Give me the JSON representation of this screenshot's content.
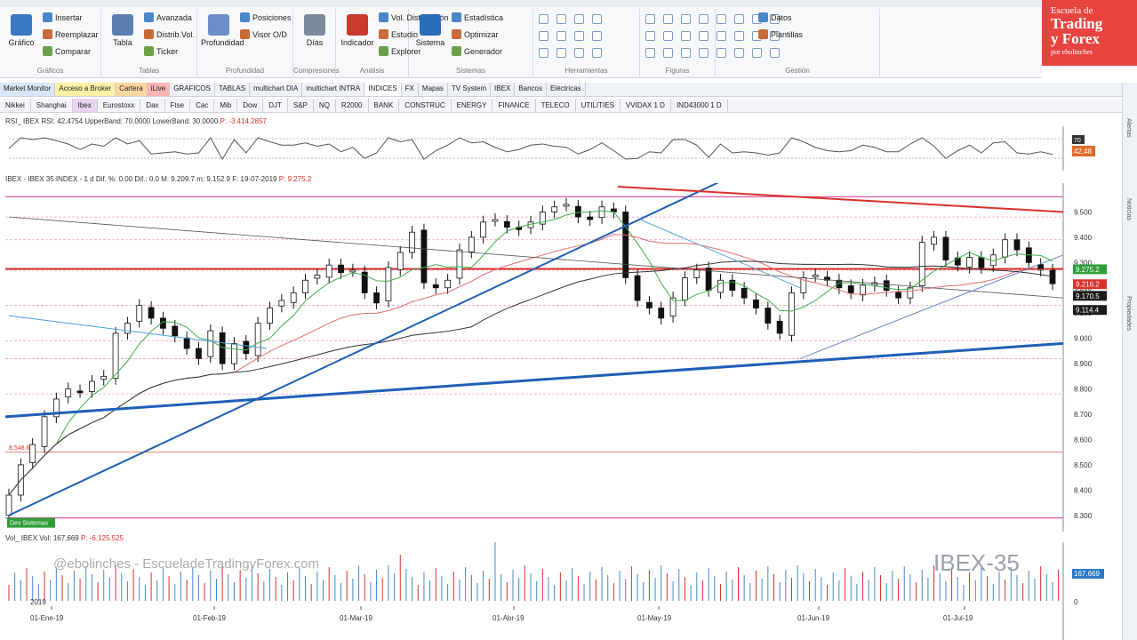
{
  "ribbon": {
    "groups": [
      {
        "label": "Gráficos",
        "big": "Gráfico",
        "items": [
          "Insertar",
          "Reemplazar",
          "Comparar"
        ]
      },
      {
        "label": "Tablas",
        "big": "Tabla",
        "items": [
          "Avanzada",
          "Distrib.Vol.",
          "Ticker"
        ]
      },
      {
        "label": "Profundidad",
        "big": "Profundidad",
        "items": [
          "Posiciones",
          "Visor O/D"
        ]
      },
      {
        "label": "Compresiones",
        "big": "Días",
        "items": []
      },
      {
        "label": "Análisis",
        "big": "Indicador",
        "items": [
          "Vol. Distribución",
          "Estudio",
          "Explorer"
        ]
      },
      {
        "label": "Sistemas",
        "big": "Sistema",
        "items": [
          "Estadística",
          "Optimizar",
          "Generador"
        ]
      },
      {
        "label": "Herramientas",
        "big": "",
        "items": []
      },
      {
        "label": "Figuras",
        "big": "",
        "items": []
      },
      {
        "label": "Gestión",
        "big": "",
        "items": [
          "Datos",
          "Plantillas"
        ]
      }
    ]
  },
  "logo": {
    "line1": "Escuela de",
    "line2": "Trading",
    "line3": "y Forex",
    "line4": "por ebolinches"
  },
  "tabs": [
    "Market Monitor",
    "Acceso a Broker",
    "Cartera",
    "iLive",
    "GRAFICOS",
    "TABLAS",
    "multichart DIA",
    "multichart INTRA",
    "INDICES",
    "FX",
    "Mapas",
    "TV System",
    "IBEX",
    "Bancos",
    "Eléctricas"
  ],
  "subtabs": [
    "Nikkei",
    "Shanghai",
    "Ibex",
    "Eurostoxx",
    "Dax",
    "Ftse",
    "Cac",
    "Mib",
    "Dow",
    "DJT",
    "S&P",
    "NQ",
    "R2000",
    "BANK",
    "CONSTRUC",
    "ENERGY",
    "FINANCE",
    "TELECO",
    "UTILITIES",
    "VVIDAX 1 D",
    "IND43000 1 D"
  ],
  "rsi": {
    "title": "RSI_ IBEX RSI: 42.4754 UpperBand: 70.0000 LowerBand: 30.0000",
    "p_label": "P: -3.414.2857",
    "badge_upper": "70",
    "badge_value": "42.48"
  },
  "price_panel": {
    "title": "IBEX - IBEX 35 INDEX - 1 d Dif. %: 0.00 Dif.: 0.0 M: 9.209.7 m: 9.152.9 F: 19-07-2019",
    "p_label": "P: 9.275.2",
    "left_label_1": "8.548.6",
    "left_label_2": "Dev Sistemas"
  },
  "y_axis": [
    "9.500",
    "9.400",
    "9.300",
    "9.200",
    "9.100",
    "9.000",
    "8.900",
    "8.800",
    "8.700",
    "8.600",
    "8.500",
    "8.400",
    "8.300"
  ],
  "price_badges": [
    {
      "text": "9.275.2",
      "color": "#2e9e3a"
    },
    {
      "text": "9.216.2",
      "color": "#d9302c"
    },
    {
      "text": "9.170.5",
      "color": "#1a1a1a"
    },
    {
      "text": "9.114.4",
      "color": "#1a1a1a"
    }
  ],
  "volume": {
    "title": "Vol_ IBEX Vol: 167.669",
    "p_label": "P: -6.125.525",
    "badge": "167.669",
    "zero": "0"
  },
  "x_axis": [
    "01-Ene-19",
    "01-Feb-19",
    "01-Mar-19",
    "01-Abr-19",
    "01-May-19",
    "01-Jun-19",
    "01-Jul-19"
  ],
  "year_label": "2019",
  "watermark": "@ebolinches - EscueladeTradingyForex.com",
  "symbol_watermark": "IBEX-35",
  "sidebar": [
    "Alertas",
    "Noticias",
    "Propiedades"
  ],
  "colors": {
    "up": "#ffffff",
    "down": "#111111",
    "trend_blue": "#1f5fb8",
    "resist_red": "#d9302c",
    "pink_level": "#e05aa0"
  },
  "chart_data": {
    "type": "candlestick",
    "title": "IBEX - IBEX 35 INDEX - 1 d",
    "ylim": [
      8250,
      9600
    ],
    "closes": [
      8380,
      8500,
      8580,
      8690,
      8760,
      8800,
      8790,
      8830,
      8850,
      9020,
      9060,
      9130,
      9080,
      9040,
      9010,
      8960,
      8920,
      9030,
      8900,
      8980,
      8940,
      9060,
      9120,
      9150,
      9180,
      9230,
      9250,
      9290,
      9260,
      9270,
      9180,
      9140,
      9280,
      9340,
      9420,
      9220,
      9200,
      9230,
      9350,
      9400,
      9460,
      9470,
      9440,
      9430,
      9460,
      9500,
      9520,
      9530,
      9480,
      9470,
      9520,
      9500,
      9240,
      9150,
      9120,
      9080,
      9160,
      9240,
      9270,
      9190,
      9230,
      9190,
      9160,
      9120,
      9060,
      9020,
      9180,
      9240,
      9250,
      9230,
      9200,
      9180,
      9210,
      9220,
      9190,
      9160,
      9200,
      9380,
      9400,
      9310,
      9290,
      9320,
      9280,
      9330,
      9390,
      9350,
      9300,
      9270,
      9216
    ]
  }
}
